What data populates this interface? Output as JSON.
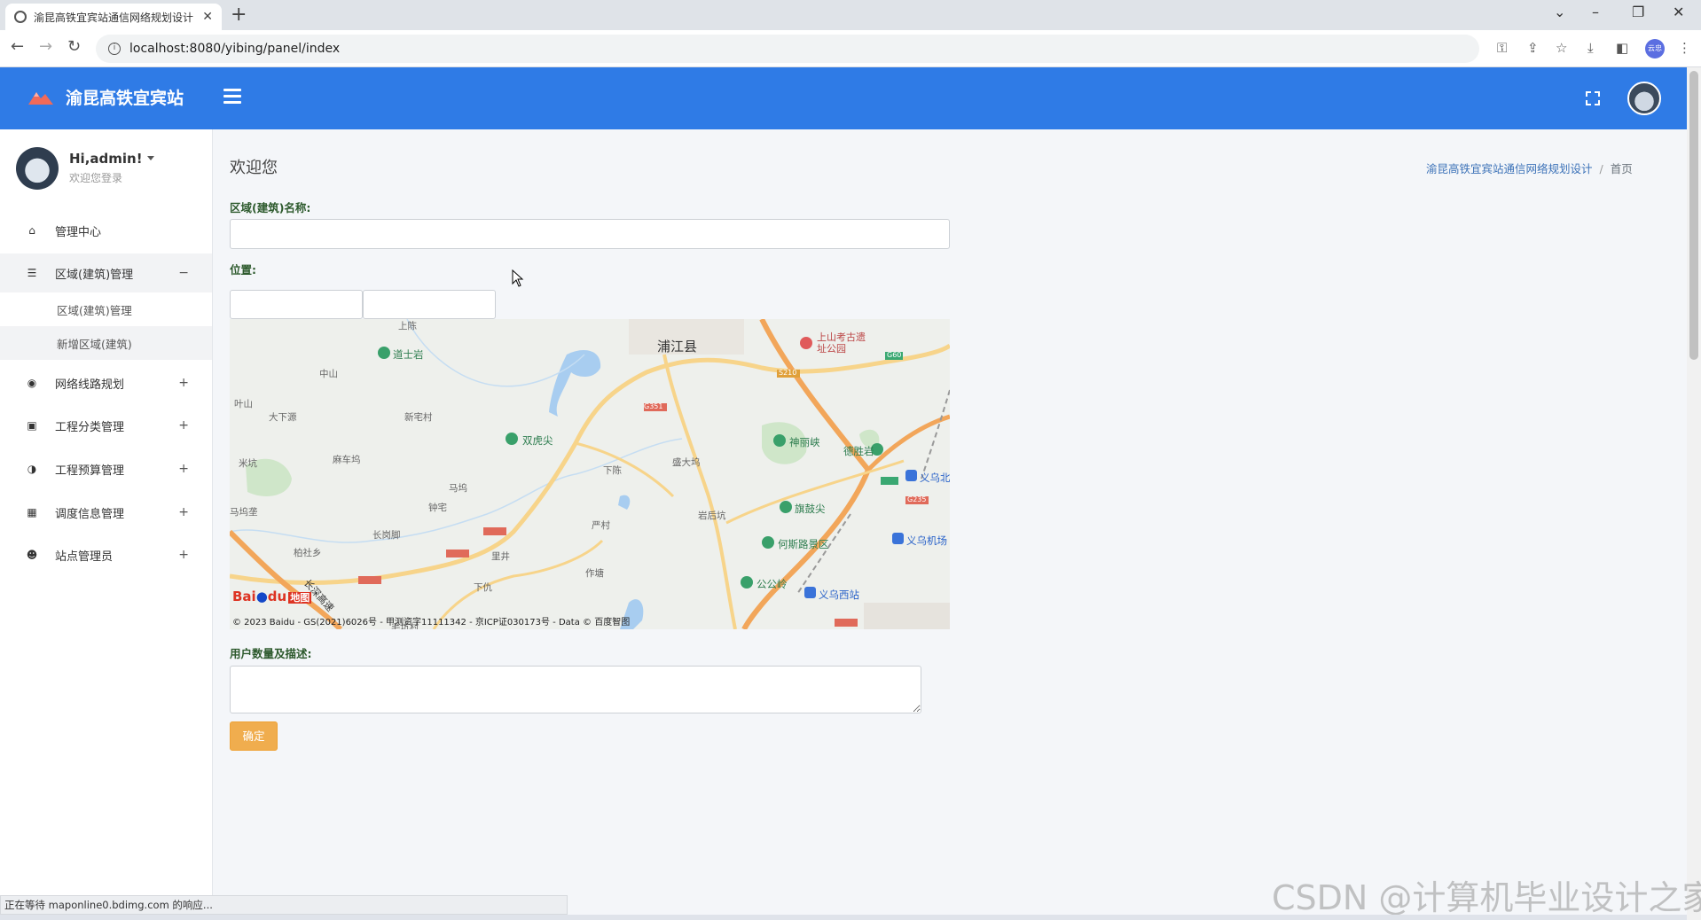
{
  "browser": {
    "tab_title": "渝昆高铁宜宾站通信网络规划设计",
    "url": "localhost:8080/yibing/panel/index",
    "profile_label": "云忠"
  },
  "header": {
    "site_title": "渝昆高铁宜宾站"
  },
  "user": {
    "name": "Hi,admin!",
    "subtitle": "欢迎您登录"
  },
  "sidebar": {
    "items": [
      {
        "label": "管理中心",
        "icon": "home-icon",
        "indicator": ""
      },
      {
        "label": "区域(建筑)管理",
        "icon": "list-icon",
        "indicator": "−"
      },
      {
        "label": "网络线路规划",
        "icon": "palette-icon",
        "indicator": "+"
      },
      {
        "label": "工程分类管理",
        "icon": "gift-icon",
        "indicator": "+"
      },
      {
        "label": "工程预算管理",
        "icon": "adjust-icon",
        "indicator": "+"
      },
      {
        "label": "调度信息管理",
        "icon": "grid-icon",
        "indicator": "+"
      },
      {
        "label": "站点管理员",
        "icon": "users-icon",
        "indicator": "+"
      }
    ],
    "sub_items": [
      {
        "label": "区域(建筑)管理"
      },
      {
        "label": "新增区域(建筑)"
      }
    ]
  },
  "main": {
    "heading": "欢迎您",
    "breadcrumb": {
      "link": "渝昆高铁宜宾站通信网络规划设计",
      "current": "首页"
    },
    "form": {
      "name_label": "区域(建筑)名称:",
      "name_value": "",
      "position_label": "位置:",
      "lng_value": "",
      "lat_value": "",
      "desc_label": "用户数量及描述:",
      "desc_value": "",
      "submit_label": "确定"
    },
    "map": {
      "labels": {
        "city": "浦江县",
        "poi1": "道士岩",
        "poi2": "双虎尖",
        "poi3": "神丽峡",
        "poi4": "德胜岩",
        "poi5": "旗鼓尖",
        "poi6": "何斯路景区",
        "poi7": "公公岭",
        "poi8": "上山考古遗址公园",
        "blue1": "义乌北",
        "blue2": "义乌机场",
        "blue3": "义乌西站",
        "v1": "上陈",
        "v2": "中山",
        "v3": "叶山",
        "v4": "大下源",
        "v5": "新宅村",
        "v6": "麻车坞",
        "v7": "马坞",
        "v8": "钟宅",
        "v9": "下陈",
        "v10": "盛大坞",
        "v11": "岩后坑",
        "v12": "长岗脚",
        "v13": "柏社乡",
        "v14": "严村",
        "v15": "里井",
        "v16": "作塘",
        "v17": "下仇",
        "v18": "毛坑村",
        "v19": "米坑",
        "v20": "马坞垄",
        "road1": "G351",
        "road2": "G60",
        "road3": "S210",
        "road4": "G235",
        "road5": "长深高速",
        "baidu_logo": "Bai",
        "baidu_logo_end": "du",
        "baidu_map": "地图",
        "copyright": "© 2023 Baidu - GS(2021)6026号 - 甲测资字11111342 - 京ICP证030173号 - Data © 百度智图"
      }
    }
  },
  "status_bar": "正在等待 maponline0.bdimg.com 的响应...",
  "watermark": "CSDN @计算机毕业设计之家",
  "colors": {
    "header_bg": "#2f7be6",
    "button_bg": "#f0ad4e",
    "label_text": "#2d5a2d"
  }
}
